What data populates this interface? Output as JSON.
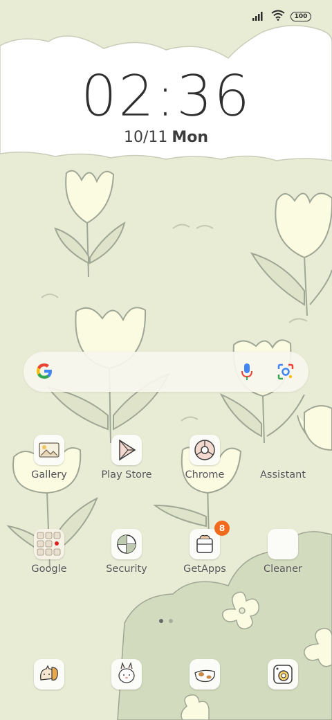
{
  "status_bar": {
    "signal_icon": "signal-icon",
    "wifi_icon": "wifi-icon",
    "battery": "100"
  },
  "clock": {
    "time": "02:36",
    "date": "10/11",
    "weekday": "Mon"
  },
  "search": {
    "google_icon": "google-logo-icon",
    "mic_icon": "mic-icon",
    "lens_icon": "camera-lens-icon"
  },
  "apps": {
    "gallery": "Gallery",
    "play_store": "Play Store",
    "chrome": "Chrome",
    "assistant": "Assistant",
    "google": "Google",
    "security": "Security",
    "getapps": "GetApps",
    "getapps_badge": "8",
    "cleaner": "Cleaner"
  },
  "page_indicator": {
    "count": 2,
    "active": 1
  },
  "colors": {
    "background": "#e9ecd5",
    "badge": "#f26a1b",
    "flower_fill": "#fbfbe2",
    "stem": "#a7b09a"
  }
}
